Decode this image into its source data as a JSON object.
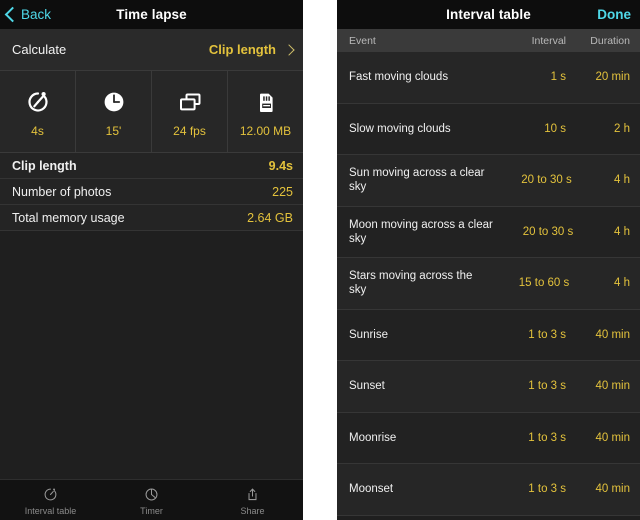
{
  "left": {
    "navbar": {
      "back_label": "Back",
      "title": "Time lapse",
      "back_icon": "chevron-left-icon"
    },
    "calculate_row": {
      "label": "Calculate",
      "value": "Clip length",
      "disclosure_icon": "chevron-right-icon"
    },
    "settings": [
      {
        "icon": "timer-icon",
        "caption": "4s"
      },
      {
        "icon": "clock-icon",
        "caption": "15'"
      },
      {
        "icon": "frames-icon",
        "caption": "24 fps"
      },
      {
        "icon": "sd-card-icon",
        "caption": "12.00 MB"
      }
    ],
    "info_rows": [
      {
        "label": "Clip length",
        "value": "9.4s",
        "bold": true
      },
      {
        "label": "Number of photos",
        "value": "225",
        "bold": false
      },
      {
        "label": "Total memory usage",
        "value": "2.64 GB",
        "bold": false
      }
    ],
    "tabs": [
      {
        "label": "Interval table",
        "icon": "interval-table-icon"
      },
      {
        "label": "Timer",
        "icon": "timer-icon"
      },
      {
        "label": "Share",
        "icon": "share-icon"
      }
    ]
  },
  "right": {
    "navbar": {
      "title": "Interval table",
      "done_label": "Done"
    },
    "columns": {
      "event": "Event",
      "interval": "Interval",
      "duration": "Duration"
    },
    "rows": [
      {
        "event": "Fast moving clouds",
        "interval": "1 s",
        "duration": "20 min"
      },
      {
        "event": "Slow moving clouds",
        "interval": "10 s",
        "duration": "2 h"
      },
      {
        "event": "Sun moving across a clear sky",
        "interval": "20 to 30 s",
        "duration": "4 h"
      },
      {
        "event": "Moon moving across a clear sky",
        "interval": "20 to 30 s",
        "duration": "4 h"
      },
      {
        "event": "Stars moving across the sky",
        "interval": "15 to 60 s",
        "duration": "4 h"
      },
      {
        "event": "Sunrise",
        "interval": "1 to 3 s",
        "duration": "40 min"
      },
      {
        "event": "Sunset",
        "interval": "1 to 3 s",
        "duration": "40 min"
      },
      {
        "event": "Moonrise",
        "interval": "1 to 3 s",
        "duration": "40 min"
      },
      {
        "event": "Moonset",
        "interval": "1 to 3 s",
        "duration": "40 min"
      }
    ]
  },
  "colors": {
    "accent_yellow": "#e3c23c",
    "accent_cyan": "#4fd8e8",
    "background": "#1f1f1f",
    "row_background": "#262626"
  }
}
